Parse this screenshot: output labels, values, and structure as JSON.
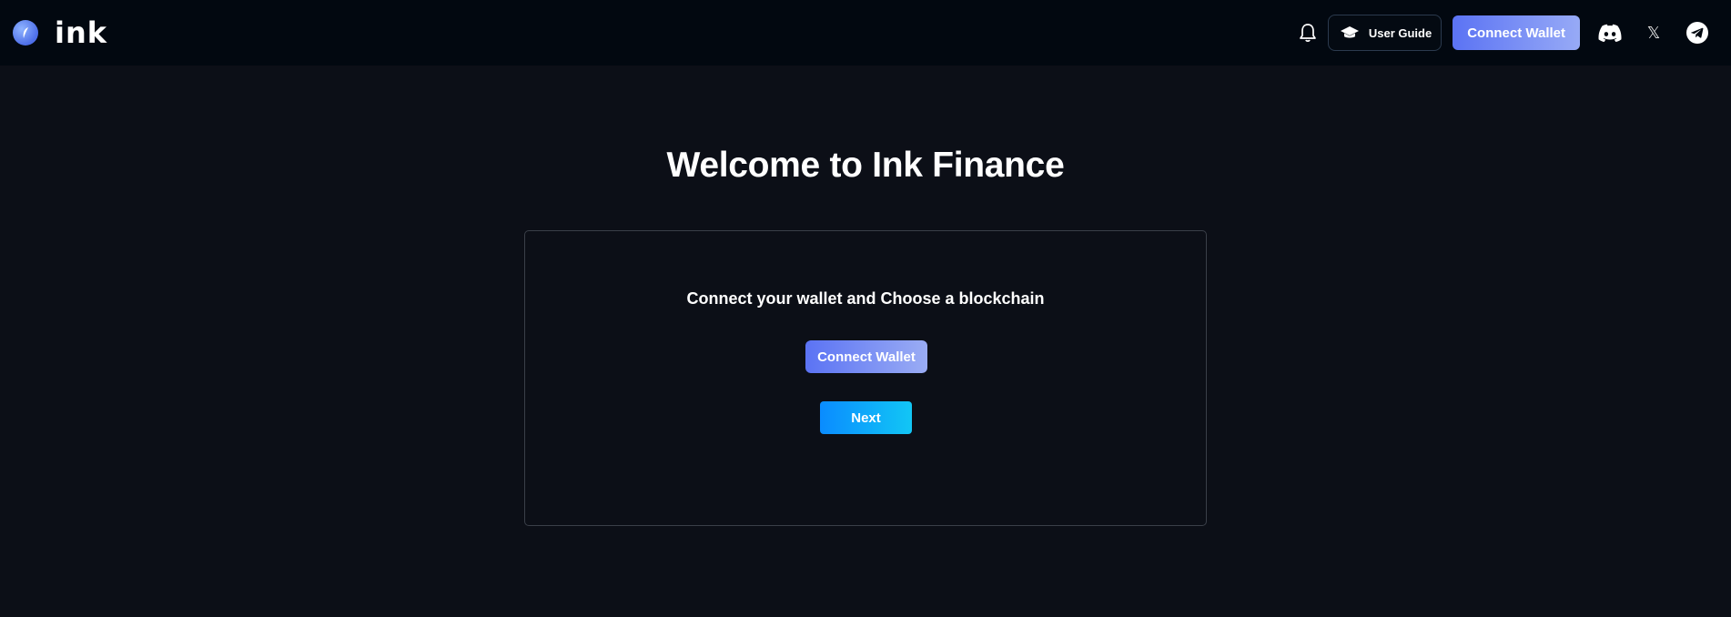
{
  "header": {
    "brand": "ink",
    "user_guide_label": "User Guide",
    "connect_wallet_label": "Connect Wallet",
    "icons": [
      "ink-logo-icon",
      "bell-icon",
      "graduation-cap-icon",
      "discord-icon",
      "x-icon",
      "telegram-icon"
    ],
    "x_glyph": "𝕏"
  },
  "main": {
    "title": "Welcome to Ink Finance",
    "card": {
      "subtitle": "Connect your wallet and Choose a blockchain",
      "connect_wallet_label": "Connect Wallet",
      "next_label": "Next"
    }
  },
  "colors": {
    "background": "#0c0f17",
    "header_background": "#020810",
    "wallet_gradient_start": "#5b73f4",
    "wallet_gradient_end": "#97aaf6",
    "next_gradient_start": "#0a8cff",
    "next_gradient_end": "#12c6f5",
    "card_border": "#3a3f48"
  }
}
